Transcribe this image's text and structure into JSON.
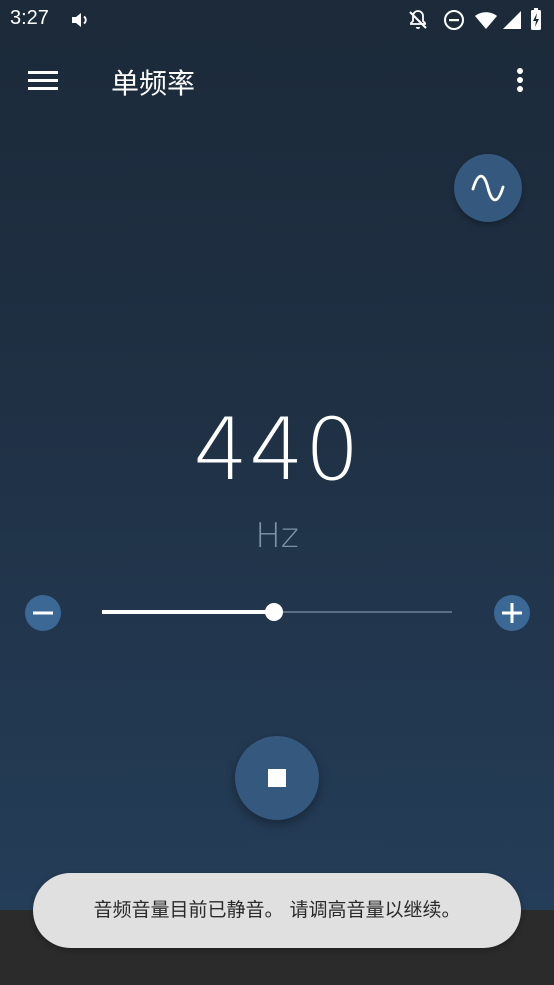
{
  "status_bar": {
    "time": "3:27",
    "icons": [
      "volume-icon",
      "notifications-off-icon",
      "do-not-disturb-icon",
      "wifi-icon",
      "cell-signal-icon",
      "battery-charging-icon"
    ]
  },
  "app_bar": {
    "title": "单频率",
    "icons": [
      "menu-icon",
      "more-vert-icon"
    ]
  },
  "waveform_button": {
    "icon": "sine-wave-icon"
  },
  "frequency": {
    "value": "440",
    "unit": "Hz"
  },
  "frequency_slider": {
    "fraction": 0.49,
    "decrease_icon": "minus-icon",
    "increase_icon": "plus-icon"
  },
  "playback": {
    "state": "playing",
    "icon": "stop-icon"
  },
  "toast": {
    "message": "音频音量目前已静音。 请调高音量以继续。"
  },
  "colors": {
    "background_top": "#1c2a39",
    "background_bottom": "#253f5b",
    "button_fill": "#35587e",
    "small_button_fill": "#3b6895",
    "unit_text": "#7f93a8",
    "toast_bg": "#e0e0e0"
  }
}
